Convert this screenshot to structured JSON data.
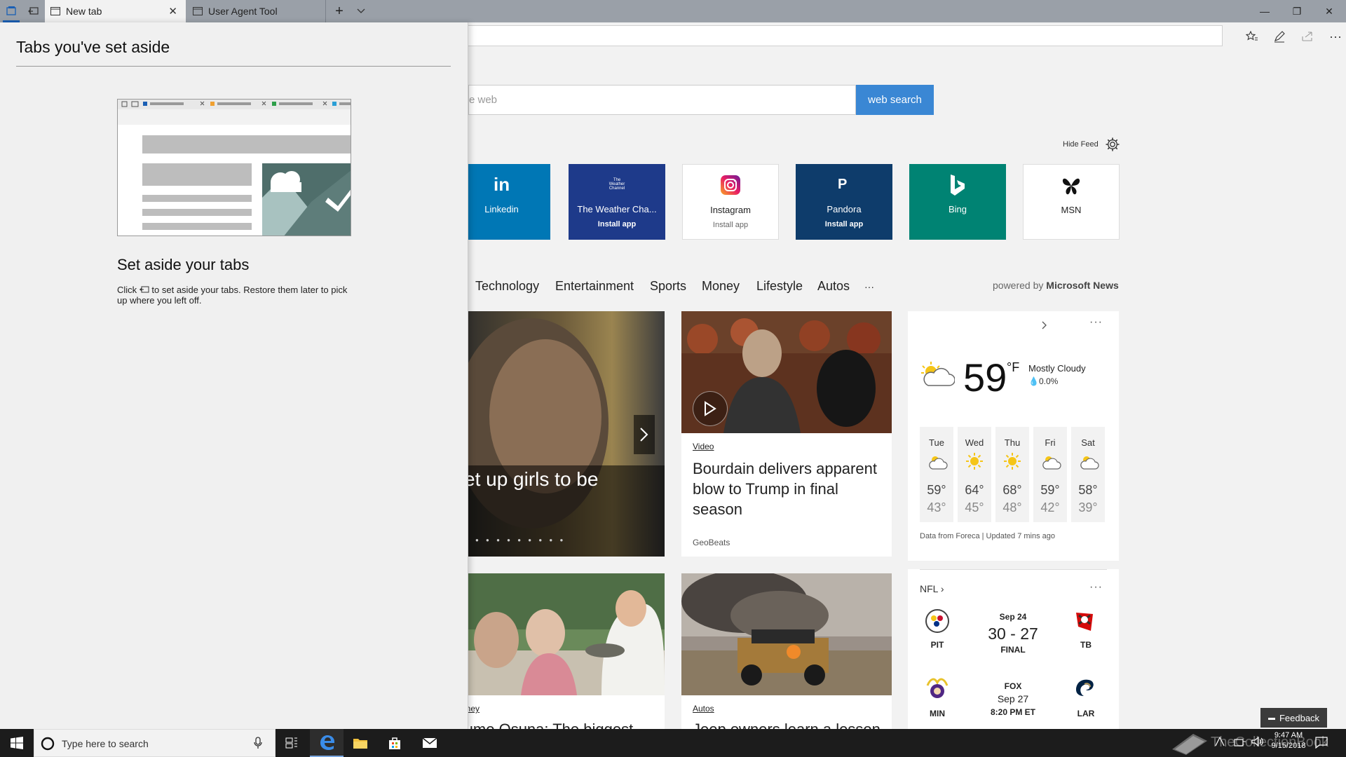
{
  "browser": {
    "tabs": [
      {
        "label": "New tab",
        "active": true
      },
      {
        "label": "User Agent Tool",
        "active": false
      }
    ],
    "new_tab_symbol": "+",
    "tab_list_symbol": "⌄",
    "window": {
      "minimize": "—",
      "maximize": "❐",
      "close": "✕"
    }
  },
  "set_aside_panel": {
    "title": "Tabs you've set aside",
    "heading": "Set aside your tabs",
    "body_before": "Click",
    "body_after": "to set aside your tabs. Restore them later to pick up where you left off."
  },
  "search": {
    "placeholder_visible": "e web",
    "button": "web search"
  },
  "feed_controls": {
    "hide_feed": "Hide Feed"
  },
  "tiles": [
    {
      "label": "Linkedin",
      "glyph": "in",
      "install": "",
      "color": "#0077b5"
    },
    {
      "label": "The Weather Cha...",
      "glyph": "The Weather Channel",
      "install": "Install app",
      "color": "#1e3a8a"
    },
    {
      "label": "Instagram",
      "glyph": "instagram-icon",
      "install": "Install app",
      "color": "#ffffff"
    },
    {
      "label": "Pandora",
      "glyph": "P",
      "install": "Install app",
      "color": "#0e3c6b"
    },
    {
      "label": "Bing",
      "glyph": "bing-icon",
      "install": "",
      "color": "#008373"
    },
    {
      "label": "MSN",
      "glyph": "msn-butterfly-icon",
      "install": "",
      "color": "#ffffff"
    }
  ],
  "categories": [
    "Technology",
    "Entertainment",
    "Sports",
    "Money",
    "Lifestyle",
    "Autos",
    "···"
  ],
  "powered_by": {
    "prefix": "powered by",
    "brand": "Microsoft News"
  },
  "news": {
    "hero": {
      "headline_partial": "set up girls to be",
      "dots": "● ● ● ● ● ● ● ● ●"
    },
    "video": {
      "category": "Video",
      "headline": "Bourdain delivers apparent blow to Trump in final season",
      "source": "GeoBeats"
    },
    "card3": {
      "category": "Money",
      "headline_partial": "Sumo Osuna: The biggest"
    },
    "card4": {
      "category": "Autos",
      "headline_partial": "Jeep owners learn a lesson"
    }
  },
  "weather": {
    "temp": "59",
    "unit": "°F",
    "condition": "Mostly Cloudy",
    "precip": "0.0%",
    "forecast": [
      {
        "day": "Tue",
        "hi": "59°",
        "lo": "43°",
        "icon": "partly-cloudy"
      },
      {
        "day": "Wed",
        "hi": "64°",
        "lo": "45°",
        "icon": "sunny"
      },
      {
        "day": "Thu",
        "hi": "68°",
        "lo": "48°",
        "icon": "sunny"
      },
      {
        "day": "Fri",
        "hi": "59°",
        "lo": "42°",
        "icon": "partly-cloudy"
      },
      {
        "day": "Sat",
        "hi": "58°",
        "lo": "39°",
        "icon": "partly-cloudy"
      }
    ],
    "source": "Data from Foreca | Updated 7 mins ago"
  },
  "nfl": {
    "title": "NFL",
    "game1": {
      "home": "PIT",
      "away": "TB",
      "date": "Sep 24",
      "score": "30 - 27",
      "status": "FINAL"
    },
    "game2": {
      "home": "MIN",
      "away": "LAR",
      "network": "FOX",
      "date": "Sep 27",
      "time": "8:20 PM ET"
    }
  },
  "feedback": "Feedback",
  "taskbar": {
    "search_placeholder": "Type here to search",
    "time": "9:47 AM",
    "date": "9/15/2018",
    "watermark": "TheCollectionBook"
  }
}
